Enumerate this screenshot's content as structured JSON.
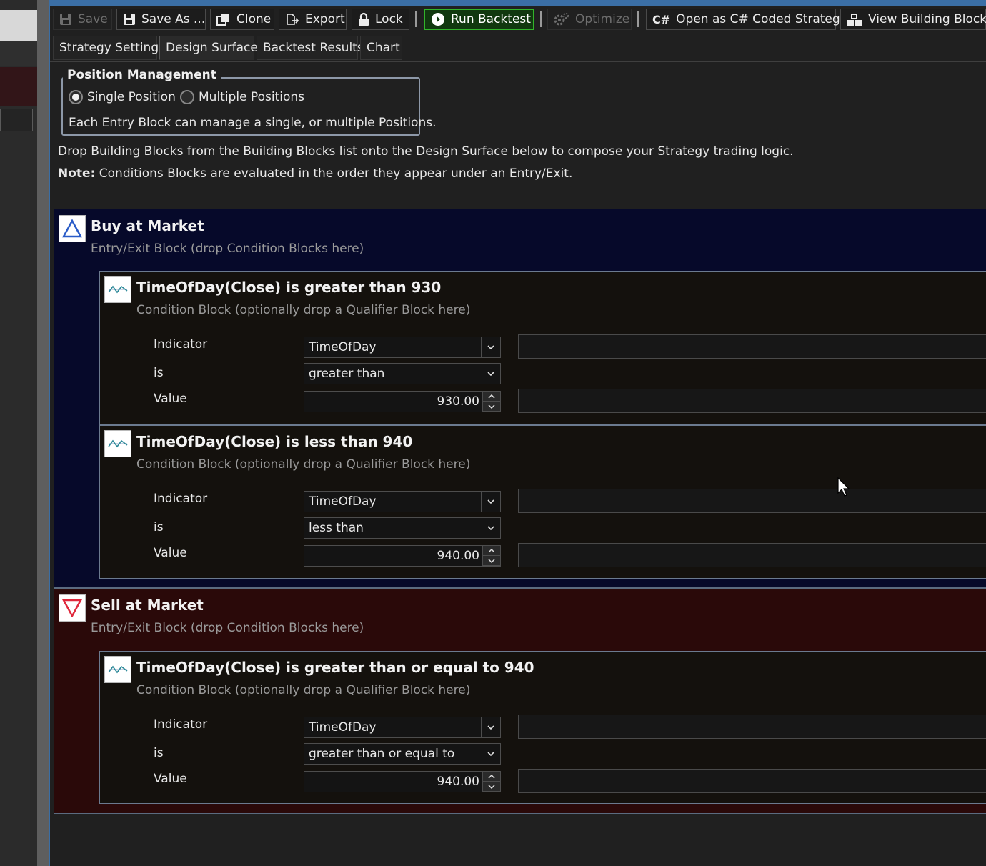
{
  "toolbar": {
    "save": "Save",
    "save_as": "Save As ...",
    "clone": "Clone",
    "export": "Export",
    "lock": "Lock",
    "run_backtest": "Run Backtest",
    "optimize": "Optimize",
    "open_csharp": "Open as C# Coded Strategy",
    "view_blocks": "View Building Blocks"
  },
  "tabs": [
    "Strategy Settings",
    "Design Surface",
    "Backtest Results",
    "Chart"
  ],
  "position_management": {
    "legend": "Position Management",
    "option_single": "Single Position",
    "option_multiple": "Multiple Positions",
    "selected": "Single Position",
    "description": "Each Entry Block can manage a single, or multiple Positions."
  },
  "info": {
    "line1_pre": "Drop Building Blocks from the ",
    "line1_link": "Building Blocks",
    "line1_post": " list onto the Design Surface below to compose your Strategy trading logic.",
    "note_label": "Note:",
    "note_text": " Conditions Blocks are evaluated in the order they appear under an Entry/Exit."
  },
  "labels": {
    "entry_sub": "Entry/Exit Block (drop Condition Blocks here)",
    "cond_sub": "Condition Block (optionally drop a Qualifier Block here)",
    "indicator": "Indicator",
    "is": "is",
    "value": "Value"
  },
  "buy": {
    "title": "Buy at Market",
    "conditions": [
      {
        "title": "TimeOfDay(Close) is greater than 930",
        "indicator": "TimeOfDay",
        "operator": "greater than",
        "value": "930.00"
      },
      {
        "title": "TimeOfDay(Close) is less than 940",
        "indicator": "TimeOfDay",
        "operator": "less than",
        "value": "940.00"
      }
    ]
  },
  "sell": {
    "title": "Sell at Market",
    "conditions": [
      {
        "title": "TimeOfDay(Close) is greater than or equal to 940",
        "indicator": "TimeOfDay",
        "operator": "greater than or equal to",
        "value": "940.00"
      }
    ]
  },
  "colors": {
    "accent": "#3b6fa6",
    "run_green": "#32b42a",
    "buy_bg": "#06092a",
    "sell_bg": "#2a0909"
  }
}
